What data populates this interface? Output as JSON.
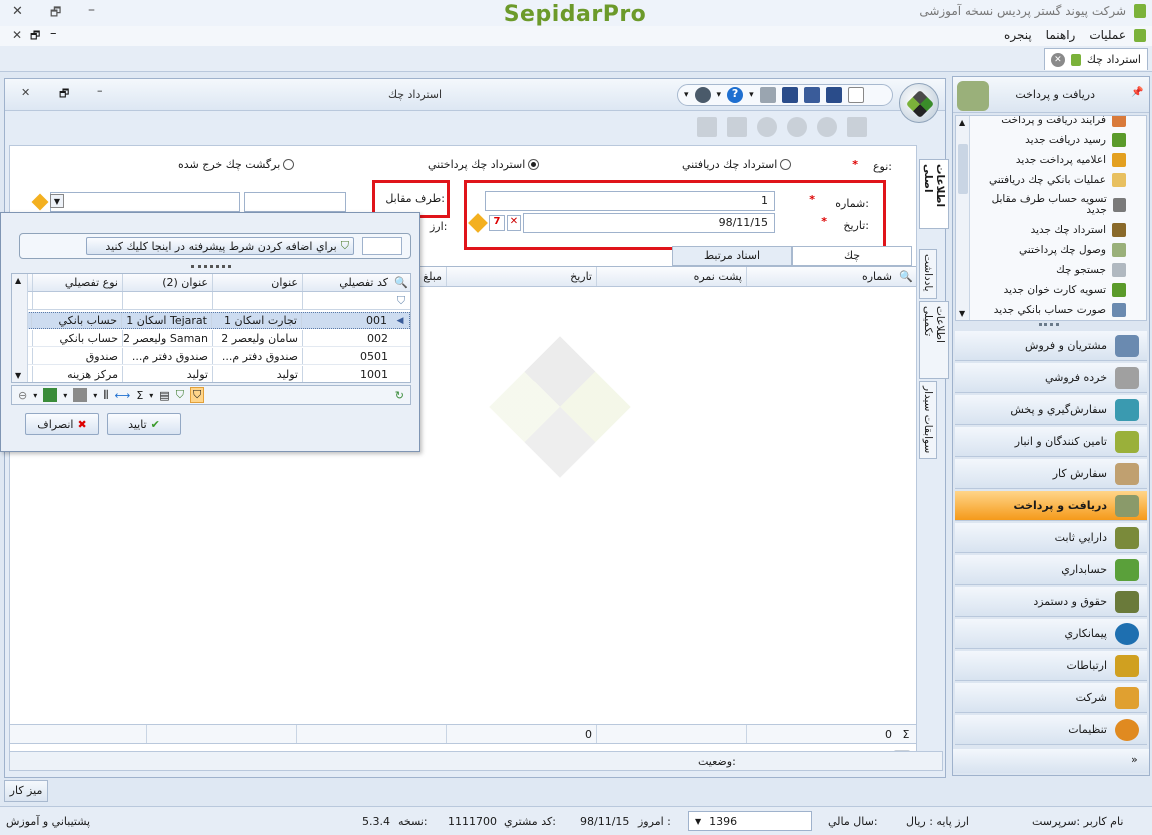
{
  "app": {
    "title": "شرکت پیوند گستر پردیس نسخه آموزشی",
    "logo": "SepidarPro",
    "brand_color": "#6c9a2a"
  },
  "menu": {
    "items": [
      "عملیات",
      "راهنما",
      "پنجره"
    ]
  },
  "doc_tab": {
    "label": "استرداد چك"
  },
  "form": {
    "title": "استرداد چك",
    "type_label": "نوع:",
    "type_options": [
      "استرداد چك دريافتني",
      "استرداد چك پرداختني",
      "برگشت چك خرج شده"
    ],
    "type_selected": "استرداد چك پرداختني",
    "number_label": "شماره:",
    "number_value": "1",
    "date_label": "تاريخ:",
    "date_value": "98/11/15",
    "counterparty_label": "طرف مقابل:",
    "currency_label": "ارز:",
    "tabs": [
      "چك",
      "اسناد مرتبط"
    ],
    "side_tabs": [
      "اطلاعات اصلی",
      "یادداشت",
      "اطلاعات تکمیلی",
      "سوابقات سیدار"
    ],
    "grid_columns": [
      "شماره",
      "پشت نمره",
      "تاريخ",
      "مبلغ"
    ],
    "footer_values": [
      "0",
      "0"
    ],
    "status_label": "وضعيت:"
  },
  "popup": {
    "filter_button": "براي اضافه كردن شرط پيشرفته در اينجا كليك كنيد",
    "columns": [
      "كد تفصيلي",
      "عنوان",
      "عنوان (2)",
      "نوع تفصيلي"
    ],
    "rows": [
      [
        "001",
        "تجارت اسكان 1",
        "Tejarat اسكان 1",
        "حساب بانكي"
      ],
      [
        "002",
        "سامان وليعصر 2",
        "Saman وليعصر 2",
        "حساب بانكي"
      ],
      [
        "0501",
        "صندوق دفتر م...",
        "صندوق دفتر م...",
        "صندوق"
      ],
      [
        "1001",
        "توليد",
        "توليد",
        "مركز هزينه"
      ]
    ],
    "ok_label": "تاييد",
    "cancel_label": "انصراف"
  },
  "nav": {
    "current_group": "دريافت و پرداخت",
    "sub_items": [
      "فرايند دريافت و پرداخت",
      "رسيد دريافت جديد",
      "اعلاميه پرداخت جديد",
      "عمليات بانكي چك دريافتني",
      "تسويه حساب طرف مقابل جديد",
      "استرداد چك جديد",
      "وصول چك پرداختني",
      "جستجو چك",
      "تسويه كارت خوان جديد",
      "صورت حساب بانكي جديد"
    ],
    "groups": [
      "مشتريان و فروش",
      "خرده فروشي",
      "سفارش‌گيري و پخش",
      "تامين كنندگان و انبار",
      "سفارش كار",
      "دريافت و پرداخت",
      "دارايي ثابت",
      "حسابداري",
      "حقوق و دستمزد",
      "پيمانكاري",
      "ارتباطات",
      "شركت",
      "تنظيمات"
    ],
    "active_group": "دريافت و پرداخت"
  },
  "desk_tab": "ميز كار",
  "status": {
    "user": "نام كاربر :سرپرست",
    "base_currency": "ارز پايه :   ريال",
    "fiscal_year_label": "سال مالي:",
    "fiscal_year": "1396",
    "today_label": "امروز :",
    "today": "98/11/15",
    "customer_code_label": "كد مشتري:",
    "customer_code": "1111700",
    "version_label": "نسخه:",
    "version": "5.3.4",
    "support": "پشتيباني و آموزش"
  }
}
